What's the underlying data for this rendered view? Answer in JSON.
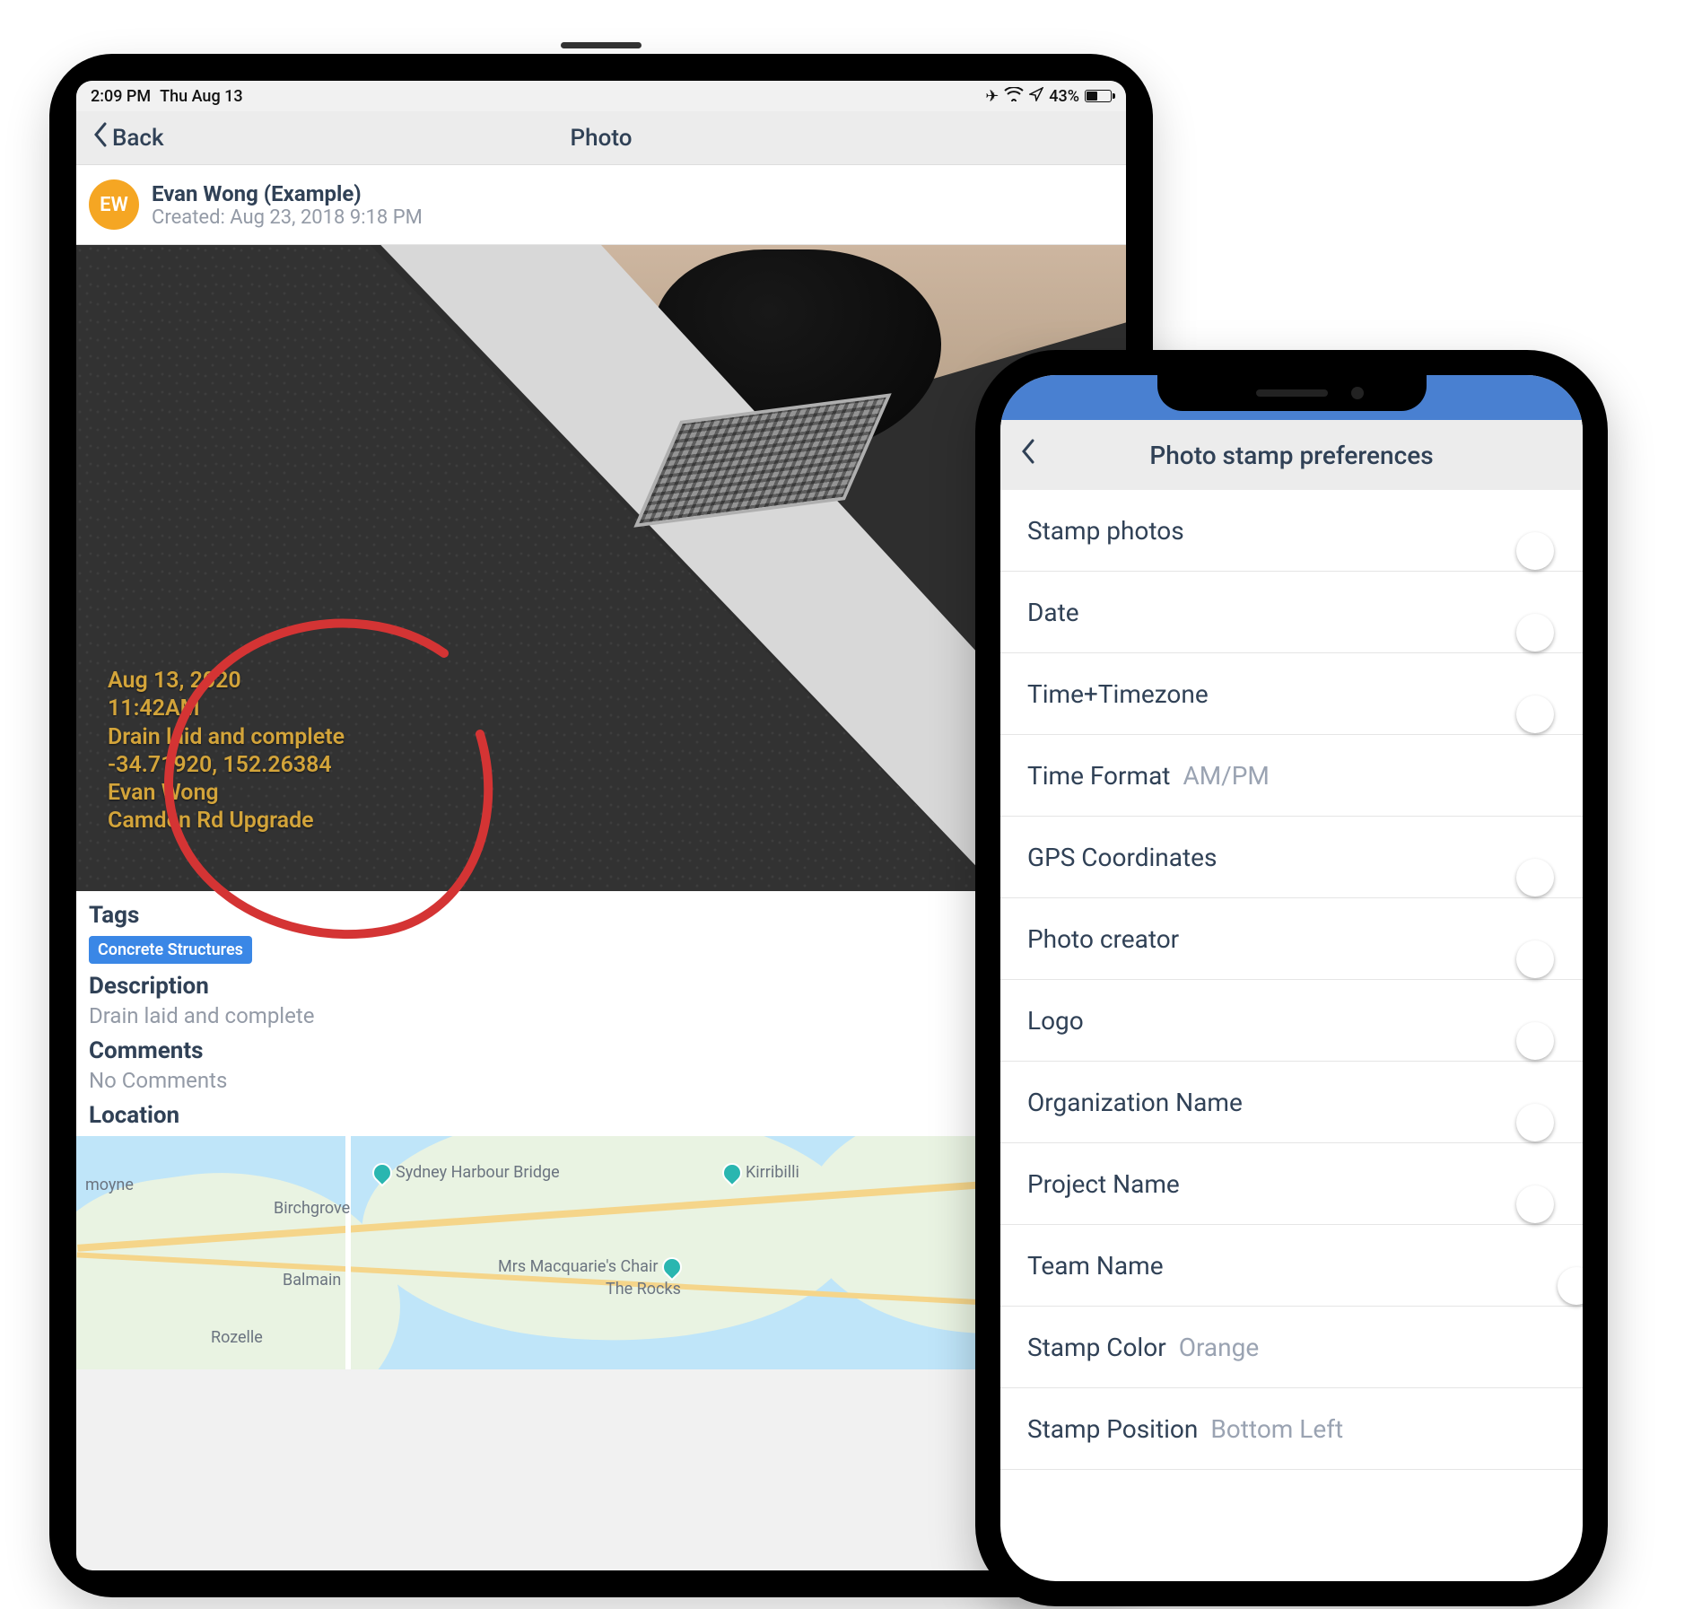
{
  "tablet": {
    "status": {
      "time": "2:09 PM",
      "date": "Thu Aug 13",
      "battery_pct": "43%"
    },
    "nav": {
      "back": "Back",
      "title": "Photo"
    },
    "author": {
      "initials": "EW",
      "name": "Evan  Wong (Example)",
      "created": "Created: Aug 23, 2018 9:18 PM"
    },
    "stamp": {
      "line1": "Aug 13, 2020",
      "line2": "11:42AM",
      "line3": "Drain laid and complete",
      "line4": "-34.71920, 152.26384",
      "line5": "Evan Wong",
      "line6": "Camden Rd Upgrade"
    },
    "sections": {
      "tags_heading": "Tags",
      "tag1": "Concrete Structures",
      "desc_heading": "Description",
      "desc_value": "Drain laid and complete",
      "comments_heading": "Comments",
      "comments_value": "No Comments",
      "location_heading": "Location"
    },
    "map": {
      "label_bridge": "Sydney Harbour Bridge",
      "label_kirribilli": "Kirribilli",
      "label_birchgrove": "Birchgrove",
      "label_balmain": "Balmain",
      "label_rozelle": "Rozelle",
      "label_moyne": "moyne",
      "label_chair": "Mrs Macquarie's Chair",
      "label_rocks": "The Rocks",
      "zoom_in": "+",
      "zoom_out": "−"
    }
  },
  "phone": {
    "nav": {
      "title": "Photo stamp preferences"
    },
    "rows": [
      {
        "label": "Stamp photos",
        "type": "toggle",
        "on": true
      },
      {
        "label": "Date",
        "type": "toggle",
        "on": true
      },
      {
        "label": "Time+Timezone",
        "type": "toggle",
        "on": true
      },
      {
        "label": "Time Format",
        "type": "value",
        "value": "AM/PM"
      },
      {
        "label": "GPS Coordinates",
        "type": "toggle",
        "on": true
      },
      {
        "label": "Photo creator",
        "type": "toggle",
        "on": true
      },
      {
        "label": "Logo",
        "type": "toggle",
        "on": true
      },
      {
        "label": "Organization Name",
        "type": "toggle",
        "on": true
      },
      {
        "label": "Project Name",
        "type": "toggle",
        "on": true
      },
      {
        "label": "Team Name",
        "type": "toggle",
        "on": false
      },
      {
        "label": "Stamp Color",
        "type": "color",
        "value": "Orange",
        "swatch": "#f0b544"
      },
      {
        "label": "Stamp Position",
        "type": "value",
        "value": "Bottom Left"
      }
    ]
  }
}
